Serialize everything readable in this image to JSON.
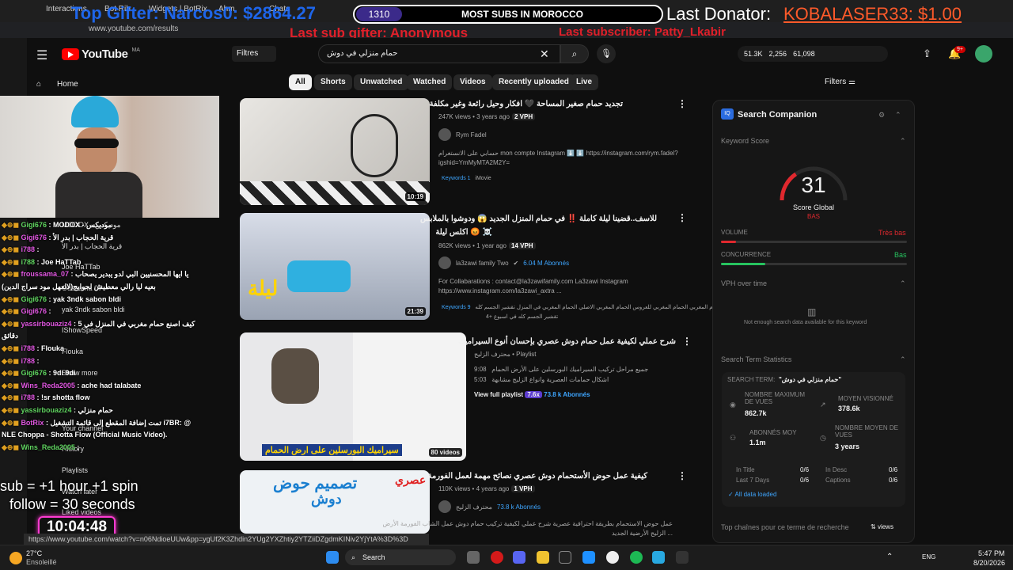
{
  "browser": {
    "tabs": [
      "Interactions",
      "Bot Rib",
      "Widgets | BotRix",
      "Ahm",
      "Chats"
    ],
    "url": "www.youtube.com/results"
  },
  "overlay": {
    "top_gifter": "Top Gifter: Narcos0: $2864.27",
    "sub_count": "1310",
    "most_subs": "MOST SUBS IN MOROCCO",
    "last_donator_label": "Last Donator:",
    "last_donator_value": "KOBALASER33: $1.00",
    "last_sub_gifter": "Last sub gifter: Anonymous",
    "last_subscriber": "Last subscriber: Patty_Lkabir",
    "subathon_line1": "sub  = +1 hour +1 spin",
    "subathon_line2": "follow = 30 seconds",
    "timer": "10:04:48"
  },
  "youtube": {
    "logo": "YouTube",
    "logo_region": "MA",
    "home": "Home",
    "filtres": "Filtres",
    "search_query": "حمام منزلي في دوش",
    "stats": [
      "51.3K",
      "2,256",
      "61,098"
    ],
    "notif_badge": "9+",
    "chips": [
      "All",
      "Shorts",
      "Unwatched",
      "Watched",
      "Videos",
      "Recently uploaded",
      "Live"
    ],
    "filters": "Filters"
  },
  "sidebar_items": [
    "MODOX - موديكس",
    "قرية الحجاب | بدر الأ",
    "Joe HaTTab",
    "Oussama 07",
    "yak 3ndk sabon bldi",
    "IShowSpeed",
    "Flouka",
    "Show more",
    "Your channel",
    "History",
    "Playlists",
    "Watch later",
    "Liked videos"
  ],
  "chat": [
    {
      "user": "Gigi676",
      "msg": "MODOX - موديكس"
    },
    {
      "user": "Gigi676",
      "msg": "قرية الحجاب | بدر الأ"
    },
    {
      "user": "i788",
      "msg": ""
    },
    {
      "user": "i788",
      "msg": "Joe HaTTab"
    },
    {
      "user": "froussama_07",
      "msg": "يا ايها المحسنيين البي لدو يبدير يصحاب"
    },
    {
      "user": "",
      "msg": "بعيه ليا رالي معطيش لحوايج(لالعهل مود سراج الدين)"
    },
    {
      "user": "Gigi676",
      "msg": "yak 3ndk sabon bldi"
    },
    {
      "user": "Gigi676",
      "msg": ""
    },
    {
      "user": "yassirbouaziz4",
      "msg": "كيف اصنع حمام مغربي في المنزل في 5"
    },
    {
      "user": "",
      "msg": "دقائق"
    },
    {
      "user": "i788",
      "msg": "Flouka"
    },
    {
      "user": "i788",
      "msg": ""
    },
    {
      "user": "Gigi676",
      "msg": "9di 9di"
    },
    {
      "user": "Wins_Reda2005",
      "msg": "ache had talabate"
    },
    {
      "user": "i788",
      "msg": "!sr shotta flow"
    },
    {
      "user": "yassirbouaziz4",
      "msg": "حمام منزلي"
    },
    {
      "user": "BotRix",
      "msg": "تمت إضافة المقطع إلى قائمة التشغيل i7BR: @"
    },
    {
      "user": "",
      "msg": "NLE Choppa - Shotta Flow (Official Music Video)."
    },
    {
      "user": "Wins_Reda2005",
      "msg": ""
    }
  ],
  "videos": [
    {
      "title": "تجديد حمام صغير المساحة 🖤 افكار وحيل رائعة وغير مكلفة",
      "views": "247K views",
      "age": "3 years ago",
      "vph": "2 VPH",
      "channel": "Rym Fadel",
      "subs": "",
      "desc1": "حسابي على الانستغرام mon compte Instagram ⬇️ ⬇️ https://instagram.com/rym.fadel?",
      "desc2": "igshid=YmMyMTA2M2Y=",
      "keywords": "Keywords 1",
      "kw_extra": "iMovie",
      "duration": "10:19"
    },
    {
      "title": "للاسف..قضينا ليلة كاملة ‼️ في حمام المنزل الجديد 😱 ودوشوا بالملابس",
      "title2": "اكلس ليلة 😡 ☠️",
      "views": "862K views",
      "age": "1 year ago",
      "vph": "14 VPH",
      "channel": "la3zawi family Two",
      "subs": "6.04 M Abonnés",
      "desc1": "For Collabarations : contact@la3zawifamily.com La3zawi Instagram",
      "desc2": "https://www.instagram.com/la3zawi_axtra ...",
      "keywords": "Keywords 9",
      "kw_extra": "الحمام المغربي   الحمام المغربي للعروس   الحمام المغربي الاصلي   الحمام المغربي في المنزل   تقشير الجسم كله",
      "kw_extra2": "تقشير الجسم كله في اسبوع   +4",
      "duration": "21:39"
    },
    {
      "title": "شرح عملي لكيفية عمل حمام دوش عصري بإحسان أنوع السيراميك",
      "channel": "محترف الزليج",
      "type": "Playlist",
      "item1_time": "9:08",
      "item1": "جميع مراحل تركيب السيراميك البورسلين على الأرض الحمام",
      "item2_time": "5:03",
      "item2": "اشكال حمامات العصرية وانواع الزليج مشابهة",
      "view_playlist": "View full playlist",
      "pl_badge": "7.6x",
      "pl_subs": "73.8 k Abonnés",
      "caption": "سيراميك البورسلين على ارض الحمام",
      "count": "80 videos"
    },
    {
      "title": "كيفية عمل حوض الأستحمام دوش عصري نصائح مهمة لعمل الفورمة",
      "views": "110K views",
      "age": "4 years ago",
      "vph": "1 VPH",
      "channel": "محترف الزليج",
      "subs": "73.8 k Abonnés",
      "desc1": "عمل حوض الاستحمام بطريقة احترافية عصرية شرح عملي لكيفية تركيب حمام دوش عمل الشاب الفورمة الأرض",
      "desc2": "الزليج الأرضية الجديد ...",
      "thumb_text1": "تصميم حوض",
      "thumb_text2": "دوش",
      "thumb_text3": "عصري"
    }
  ],
  "panel": {
    "title": "Search Companion",
    "keyword_score": "Keyword Score",
    "score": "31",
    "score_label": "Score Global",
    "score_sub": "BAS",
    "volume": "VOLUME",
    "volume_value": "Très bas",
    "concurrence": "CONCURRENCE",
    "concurrence_value": "Bas",
    "vph_title": "VPH over time",
    "vph_empty": "Not enough search data available for this keyword",
    "sts_title": "Search Term Statistics",
    "search_term_label": "SEARCH TERM:",
    "search_term": "\"حمام منزلي في دوش\"",
    "max_views_label": "NOMBRE MAXIMUM DE VUES",
    "max_views": "862.7k",
    "avg_views_label": "MOYEN VISIONNÉ",
    "avg_views": "378.6k",
    "subs_label": "ABONNÉS MOY",
    "subs": "1.1m",
    "age_label": "NOMBRE MOYEN DE VUES",
    "age": "3 years",
    "in_title": "In Title",
    "in_title_v": "0/6",
    "last7": "Last 7 Days",
    "last7_v": "0/6",
    "in_desc": "In Desc",
    "in_desc_v": "0/6",
    "captions": "Captions",
    "captions_v": "0/6",
    "all_data": "All data loaded",
    "top_channels": "Top chaînes pour ce terme de recherche",
    "views_sort": "views",
    "volume_level": 0.08,
    "concurrence_level": 0.24,
    "score_fraction": 0.31
  },
  "taskbar": {
    "weather_temp": "27°C",
    "weather_desc": "Ensoleillé",
    "search": "Search",
    "lang": "ENG",
    "time": "5:47 PM",
    "date": "8/20/2026"
  },
  "status_url": "https://www.youtube.com/watch?v=n06NdioeUUw&pp=ygUf2K3Zhdin2YUg2YXZhtiy2YTZiiDZgdmKINiv2YjYtA%3D%3D",
  "colors": {
    "accent_red": "#ff0000",
    "link_blue": "#3ea6ff",
    "overlay_blue": "#1e6dff",
    "timer_pink": "#ff3bd2"
  }
}
